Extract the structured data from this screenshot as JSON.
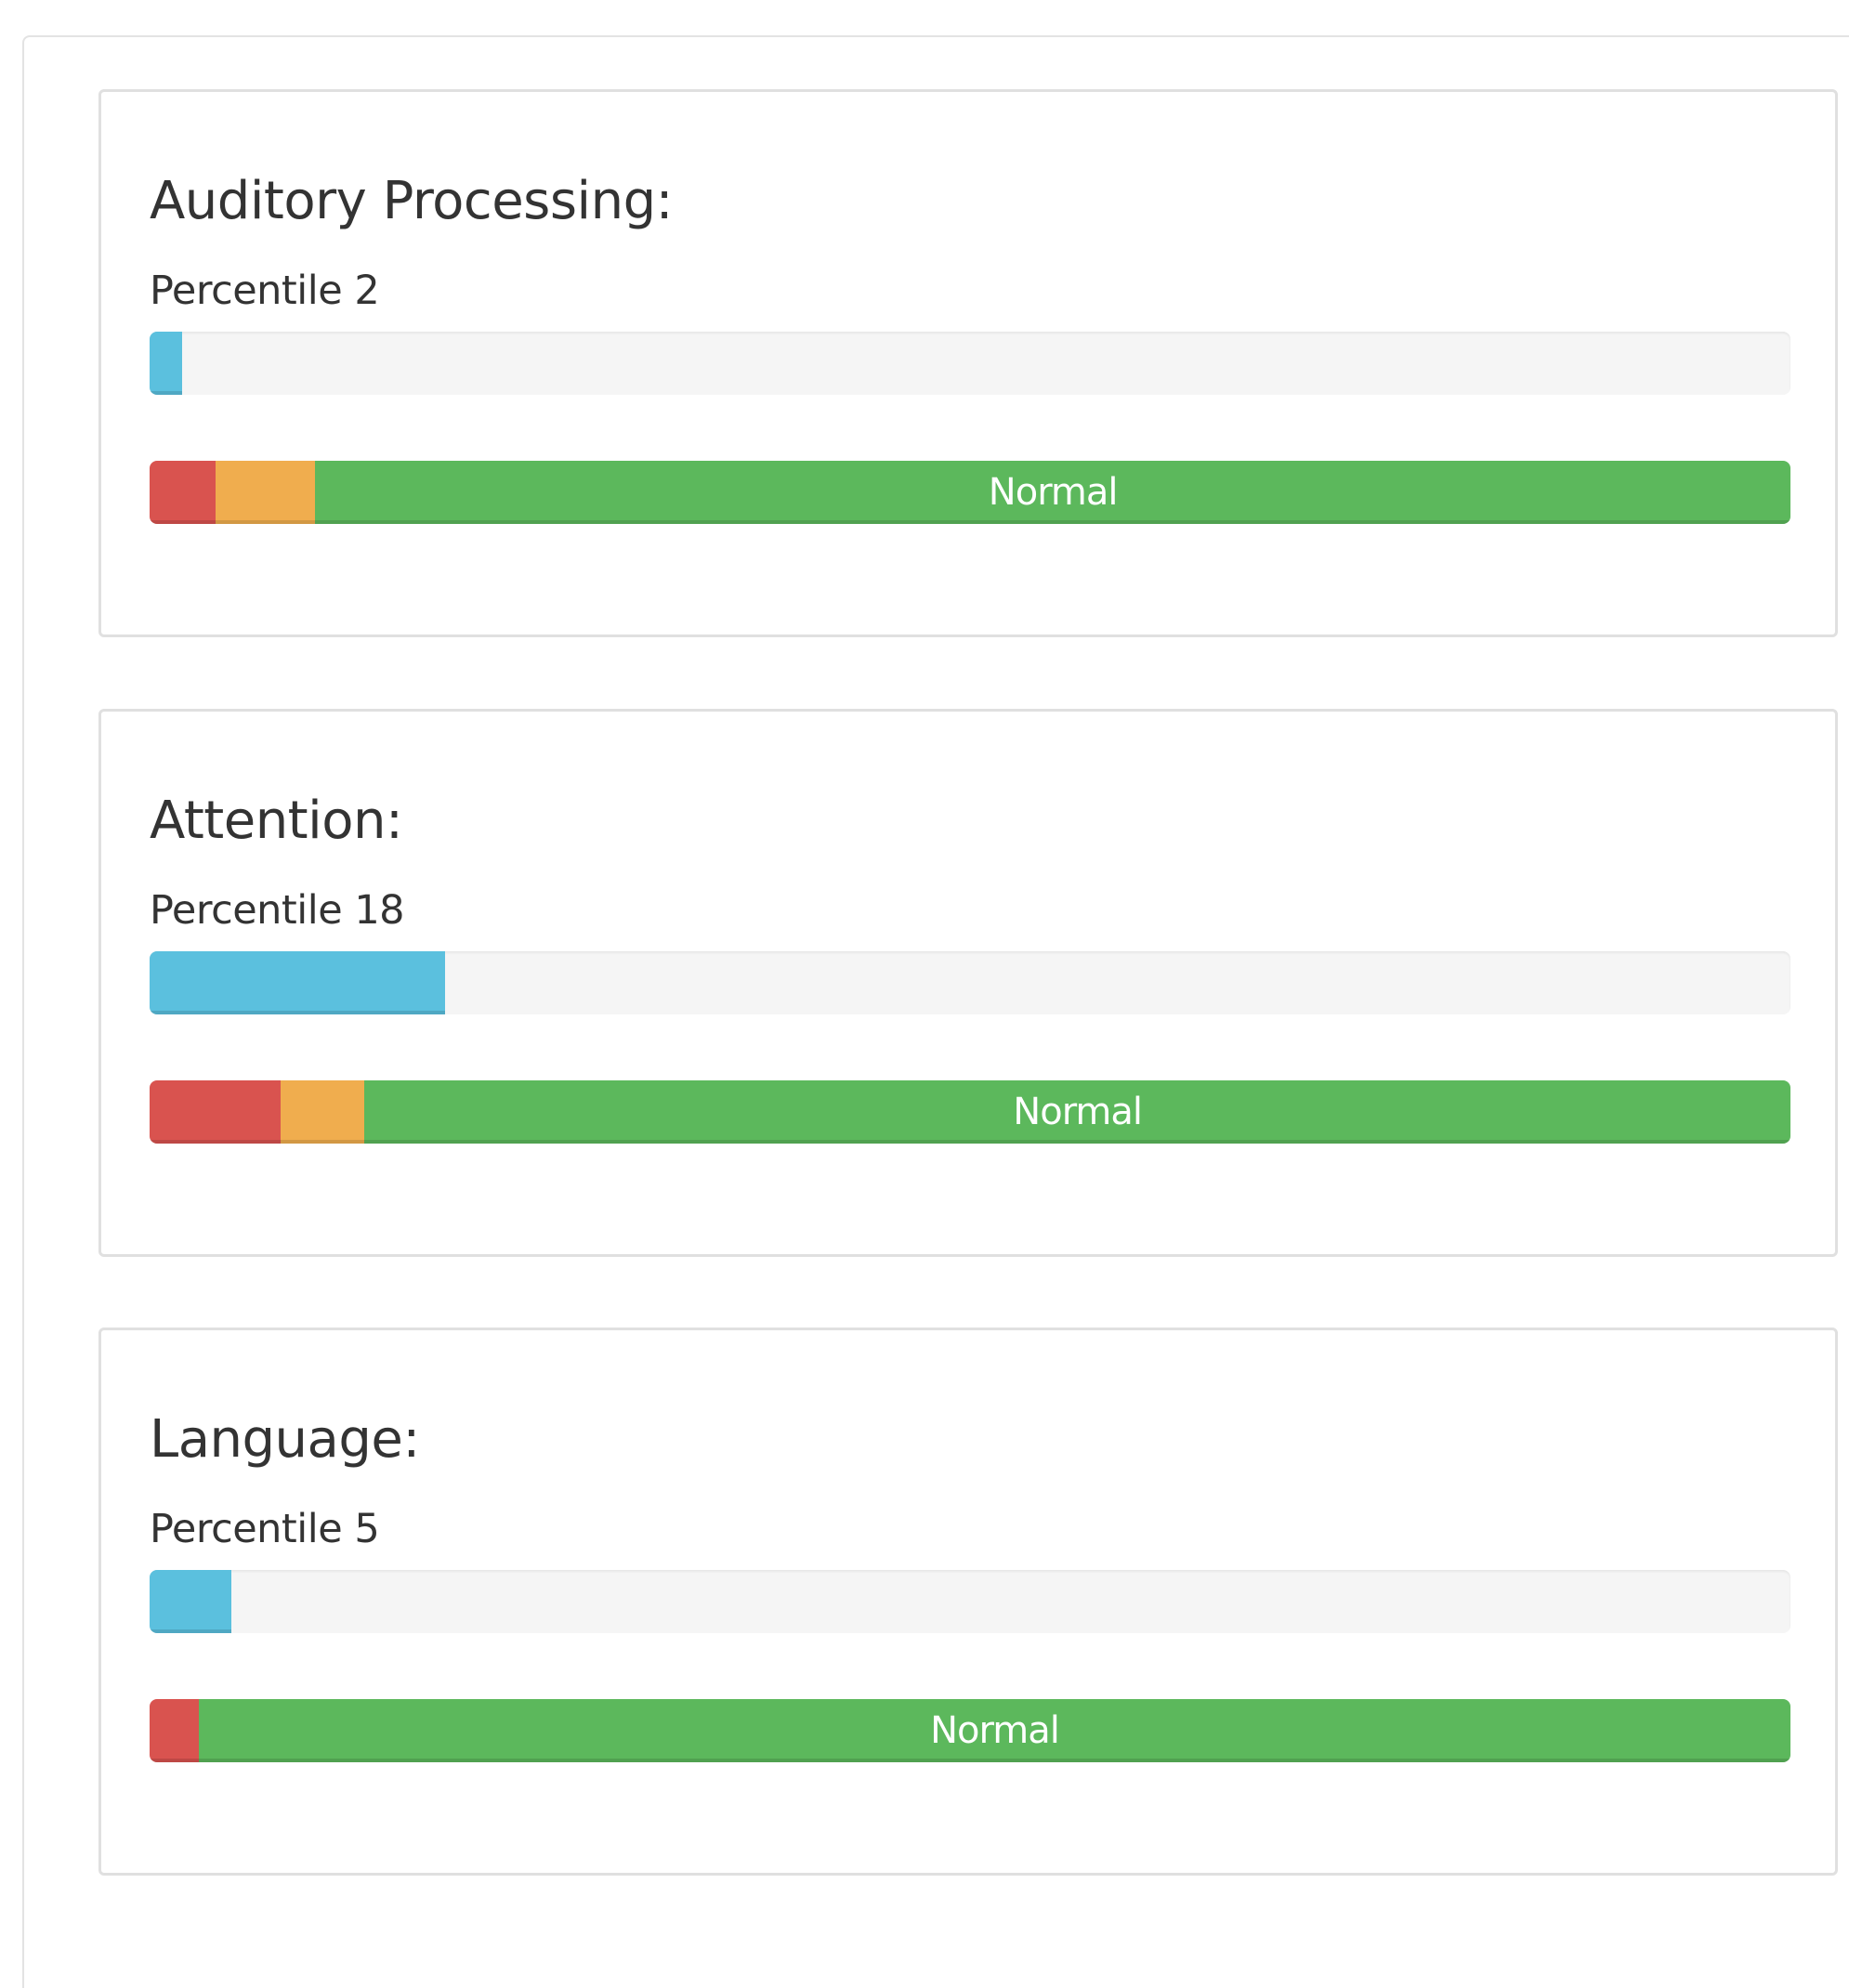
{
  "cards": [
    {
      "title": "Auditory Processing:",
      "percentile_label": "Percentile 2",
      "percentile_value": 2,
      "status_segments": [
        {
          "color": "red",
          "fraction": 0.04
        },
        {
          "color": "orange",
          "fraction": 0.061
        },
        {
          "color": "green",
          "fraction": 0.899,
          "label": "Normal"
        }
      ]
    },
    {
      "title": "Attention:",
      "percentile_label": "Percentile 18",
      "percentile_value": 18,
      "status_segments": [
        {
          "color": "red",
          "fraction": 0.08
        },
        {
          "color": "orange",
          "fraction": 0.051
        },
        {
          "color": "green",
          "fraction": 0.869,
          "label": "Normal"
        }
      ]
    },
    {
      "title": "Language:",
      "percentile_label": "Percentile 5",
      "percentile_value": 5,
      "status_segments": [
        {
          "color": "red",
          "fraction": 0.03
        },
        {
          "color": "green",
          "fraction": 0.97,
          "label": "Normal"
        }
      ]
    }
  ],
  "colors": {
    "progress_fill": "#5bc0de",
    "red": "#d9534f",
    "orange": "#f0ad4e",
    "green": "#5cb85c",
    "track": "#f5f5f5"
  }
}
